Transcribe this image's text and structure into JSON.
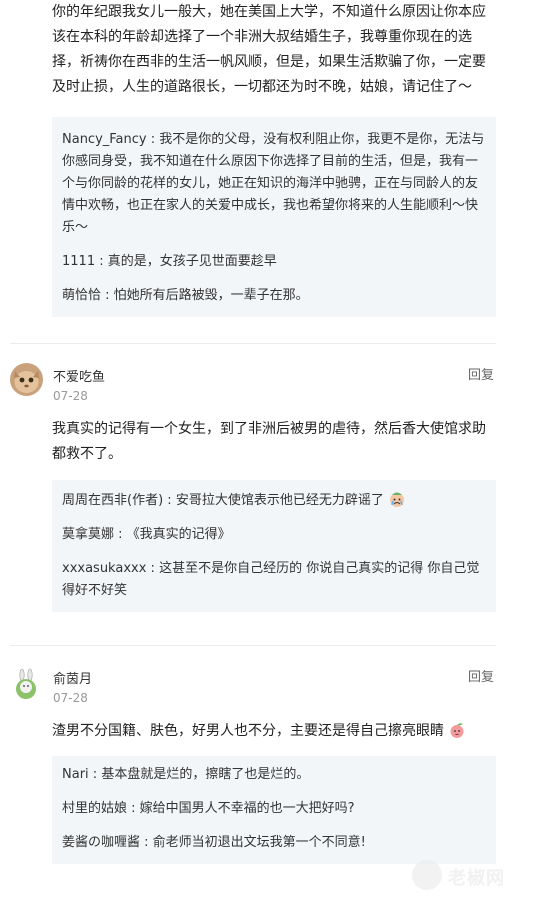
{
  "top_text": "你的年纪跟我女儿一般大，她在美国上大学，不知道什么原因让你本应该在本科的年龄却选择了一个非洲大叔结婚生子，我尊重你现在的选择，祈祷你在西非的生活一帆风顺，但是，如果生活欺骗了你，一定要及时止损，人生的道路很长，一切都还为时不晚，姑娘，请记住了～",
  "top_replies": [
    {
      "author": "Nancy_Fancy",
      "text": "我不是你的父母，没有权利阻止你，我更不是你，无法与你感同身受，我不知道在什么原因下你选择了目前的生活，但是，我有一个与你同龄的花样的女儿，她正在知识的海洋中驰骋，正在与同龄人的友情中欢畅，也正在家人的关爱中成长，我也希望你将来的人生能顺利～快乐～"
    },
    {
      "author": "1111",
      "text": "真的是，女孩子见世面要趁早"
    },
    {
      "author": "萌恰恰",
      "text": "怕她所有后路被毁，一辈子在那。"
    }
  ],
  "comments": [
    {
      "name": "不爱吃鱼",
      "date": "07-28",
      "reply_label": "回复",
      "avatar_icon": "cat-avatar",
      "body": "我真实的记得有一个女生，到了非洲后被男的虐待，然后香大使馆求助都救不了。",
      "replies": [
        {
          "author": "周周在西非(作者)",
          "text": "安哥拉大使馆表示他已经无力辟谣了",
          "emoji": "crying-emoji"
        },
        {
          "author": "莫拿莫娜",
          "text": "《我真实的记得》"
        },
        {
          "author": "xxxasukaxxx",
          "text": "这甚至不是你自己经历的 你说自己真实的记得 你自己觉得好不好笑"
        }
      ]
    },
    {
      "name": "俞茵月",
      "date": "07-28",
      "reply_label": "回复",
      "avatar_icon": "rabbit-avatar",
      "body": "渣男不分国籍、肤色，好男人也不分，主要还是得自己擦亮眼睛",
      "body_emoji": "peach-emoji",
      "replies": [
        {
          "author": "Nari",
          "text": "基本盘就是烂的，擦瞎了也是烂的。"
        },
        {
          "author": "村里的姑娘",
          "text": "嫁给中国男人不幸福的也一大把好吗?"
        },
        {
          "author": "姜酱の咖喱酱",
          "text": "俞老师当初退出文坛我第一个不同意!"
        }
      ]
    }
  ],
  "watermark": {
    "text": "老椒网"
  }
}
